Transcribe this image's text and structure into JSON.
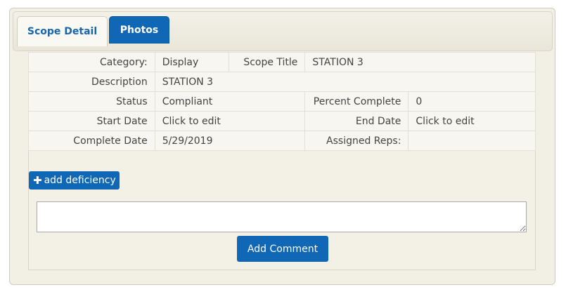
{
  "tabs": [
    {
      "label": "Scope Detail",
      "active": true
    },
    {
      "label": "Photos",
      "active": false
    }
  ],
  "detail": {
    "category_label": "Category:",
    "category_value": "Display",
    "scope_title_label": "Scope Title",
    "scope_title_value": "STATION 3",
    "description_label": "Description",
    "description_value": "STATION 3",
    "status_label": "Status",
    "status_value": "Compliant",
    "percent_label": "Percent Complete",
    "percent_value": "0",
    "start_label": "Start Date",
    "start_value": "Click to edit",
    "end_label": "End Date",
    "end_value": "Click to edit",
    "complete_label": "Complete Date",
    "complete_value": "5/29/2019",
    "reps_label": "Assigned Reps:",
    "reps_value": ""
  },
  "actions": {
    "add_deficiency_icon": "plus-icon",
    "add_deficiency_label": "add deficiency",
    "comment_value": "",
    "add_comment_label": "Add Comment"
  },
  "colors": {
    "accent": "#0f67b6",
    "panel_bg": "#f2f0e4",
    "active_tab_text": "#1a66ad"
  }
}
